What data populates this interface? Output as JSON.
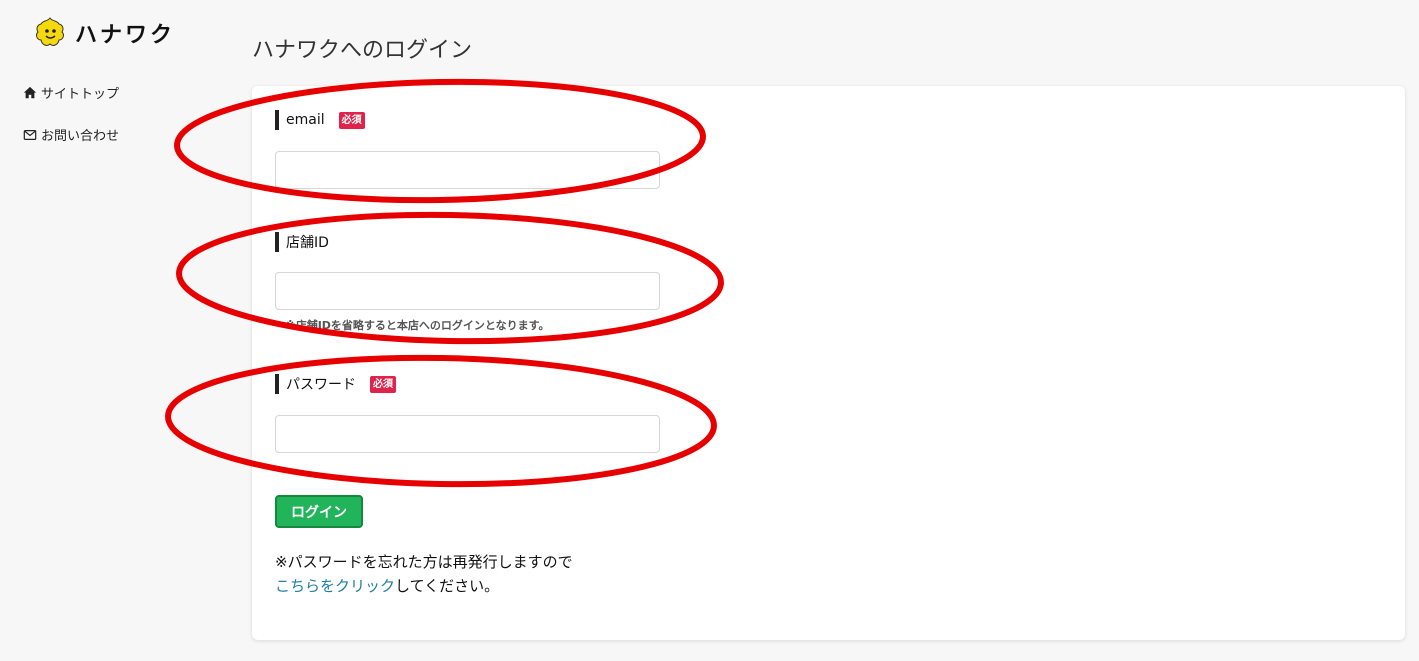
{
  "logo": {
    "text": "ハナワク"
  },
  "nav": [
    {
      "label": "サイトトップ",
      "icon": "home-icon"
    },
    {
      "label": "お問い合わせ",
      "icon": "envelope-icon"
    }
  ],
  "page_title": "ハナワクへのログイン",
  "form": {
    "email": {
      "label": "email",
      "required": "必須",
      "value": "",
      "placeholder": ""
    },
    "store_id": {
      "label": "店舗ID",
      "value": "",
      "placeholder": "",
      "hint": "※店舗IDを省略すると本店へのログインとなります。"
    },
    "password": {
      "label": "パスワード",
      "required": "必須",
      "value": "",
      "placeholder": ""
    },
    "submit_label": "ログイン"
  },
  "forgot": {
    "line1": "※パスワードを忘れた方は再発行しますので",
    "link": "こちらをクリック",
    "line2_rest": "してください。"
  },
  "colors": {
    "accent_green": "#22b45a",
    "required_badge": "#e0234a",
    "link": "#1f7fa3",
    "annotation_red": "#e60000"
  }
}
